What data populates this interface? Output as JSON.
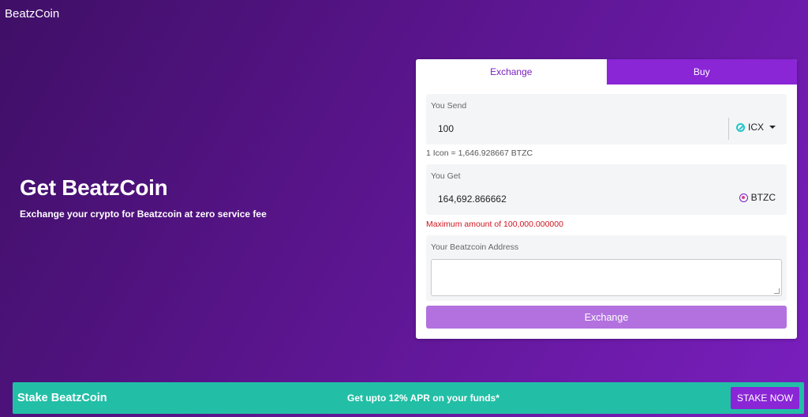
{
  "brand": "BeatzCoin",
  "hero": {
    "title": "Get BeatzCoin",
    "subtitle": "Exchange your crypto for Beatzcoin at zero service fee"
  },
  "tabs": [
    {
      "label": "Exchange",
      "active": true
    },
    {
      "label": "Buy",
      "active": false
    }
  ],
  "send": {
    "label": "You Send",
    "value": "100",
    "currency": "ICX",
    "currency_icon": "icx-icon"
  },
  "rate": "1 Icon = 1,646.928667 BTZC",
  "get": {
    "label": "You Get",
    "value": "164,692.866662",
    "currency": "BTZC",
    "currency_icon": "btzc-icon"
  },
  "error": "Maximum amount of 100,000.000000",
  "address": {
    "label": "Your Beatzcoin Address",
    "value": ""
  },
  "exchange_button": "Exchange",
  "stake": {
    "title": "Stake BeatzCoin",
    "promo": "Get upto 12% APR on your funds*",
    "button": "STAKE NOW"
  },
  "colors": {
    "accent": "#8a26d6",
    "teal": "#22bfa6",
    "error": "#d0141f"
  }
}
